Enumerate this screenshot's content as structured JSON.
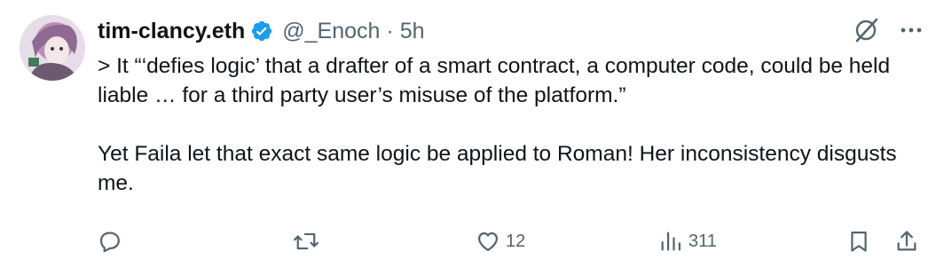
{
  "author": {
    "display_name": "tim-clancy.eth",
    "handle": "@_Enoch",
    "separator": "·",
    "time": "5h",
    "verified": true
  },
  "tweet": {
    "paragraph1": "> It “‘defies logic’ that a drafter of a smart contract, a computer code, could be held liable … for a third party user’s misuse of the platform.”",
    "paragraph2": "Yet Faila let that exact same logic be applied to Roman! Her inconsistency disgusts me."
  },
  "actions": {
    "replies": "",
    "reposts": "",
    "likes": "12",
    "views": "311"
  },
  "colors": {
    "text": "#0f1419",
    "secondary": "#536471",
    "verified": "#1d9bf0"
  },
  "icons": {
    "verified": "verified-badge-icon",
    "grok": "grok-icon",
    "more": "more-icon",
    "reply": "reply-icon",
    "repost": "repost-icon",
    "like": "heart-icon",
    "views": "views-icon",
    "bookmark": "bookmark-icon",
    "share": "share-icon"
  }
}
